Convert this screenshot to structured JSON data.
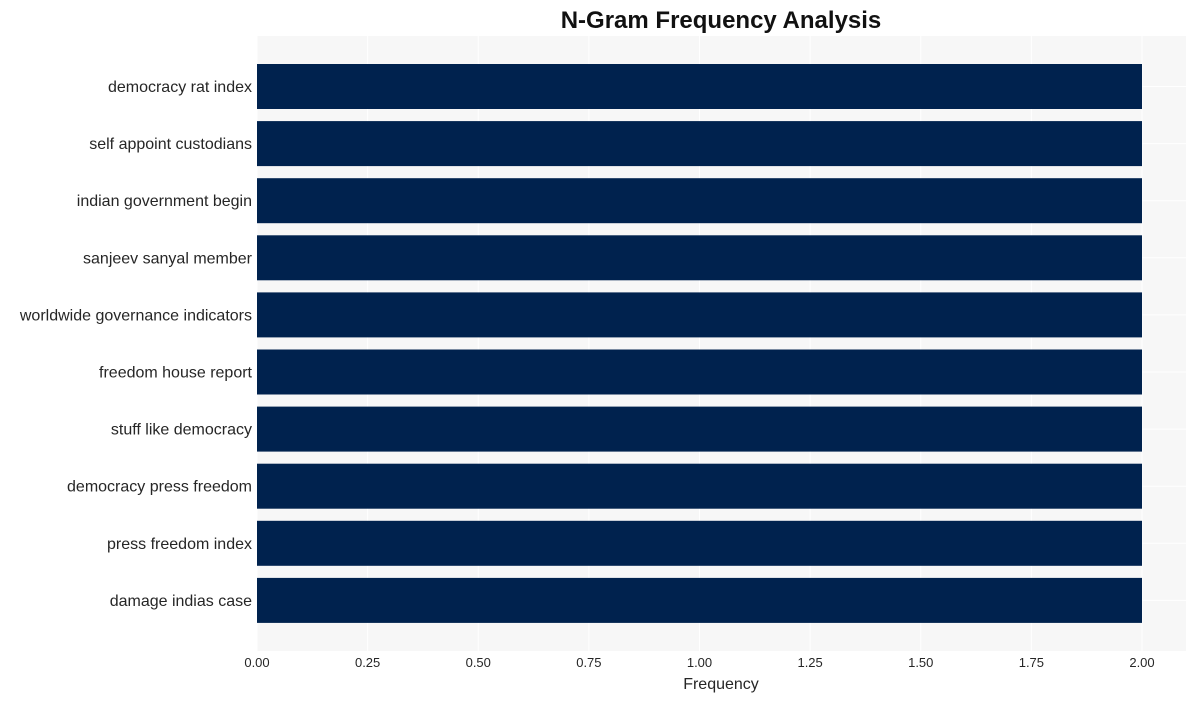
{
  "chart_data": {
    "type": "bar",
    "orientation": "horizontal",
    "title": "N-Gram Frequency Analysis",
    "xlabel": "Frequency",
    "ylabel": "",
    "categories": [
      "democracy rat index",
      "self appoint custodians",
      "indian government begin",
      "sanjeev sanyal member",
      "worldwide governance indicators",
      "freedom house report",
      "stuff like democracy",
      "democracy press freedom",
      "press freedom index",
      "damage indias case"
    ],
    "values": [
      2,
      2,
      2,
      2,
      2,
      2,
      2,
      2,
      2,
      2
    ],
    "xlim": [
      0,
      2.1
    ],
    "xticks": [
      0,
      0.25,
      0.5,
      0.75,
      1.0,
      1.25,
      1.5,
      1.75,
      2.0
    ],
    "xtick_labels": [
      "0.00",
      "0.25",
      "0.50",
      "0.75",
      "1.00",
      "1.25",
      "1.50",
      "1.75",
      "2.00"
    ],
    "grid": true,
    "legend": "none",
    "colors": {
      "bar": "#00224e",
      "plot_background": "#f7f7f7",
      "grid": "#ffffff"
    }
  }
}
